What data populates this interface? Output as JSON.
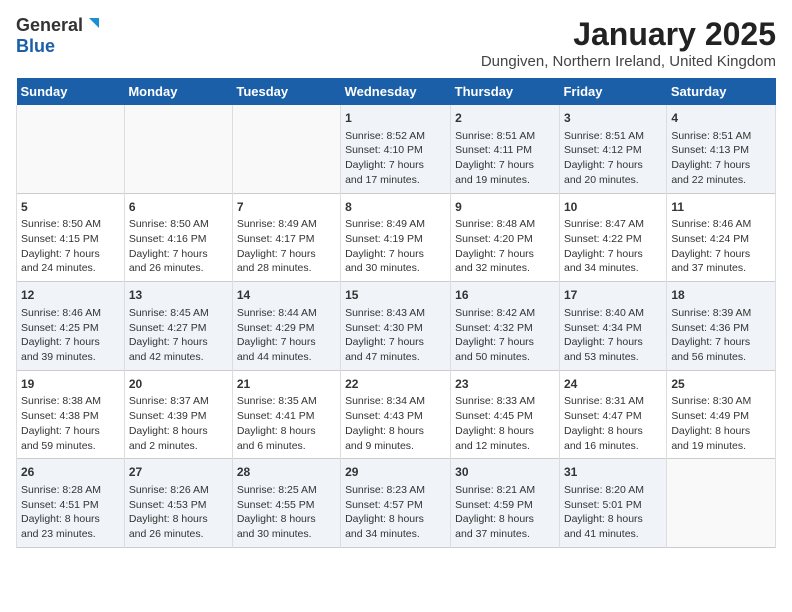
{
  "header": {
    "logo_general": "General",
    "logo_blue": "Blue",
    "month": "January 2025",
    "location": "Dungiven, Northern Ireland, United Kingdom"
  },
  "weekdays": [
    "Sunday",
    "Monday",
    "Tuesday",
    "Wednesday",
    "Thursday",
    "Friday",
    "Saturday"
  ],
  "weeks": [
    [
      {
        "day": "",
        "info": ""
      },
      {
        "day": "",
        "info": ""
      },
      {
        "day": "",
        "info": ""
      },
      {
        "day": "1",
        "info": "Sunrise: 8:52 AM\nSunset: 4:10 PM\nDaylight: 7 hours\nand 17 minutes."
      },
      {
        "day": "2",
        "info": "Sunrise: 8:51 AM\nSunset: 4:11 PM\nDaylight: 7 hours\nand 19 minutes."
      },
      {
        "day": "3",
        "info": "Sunrise: 8:51 AM\nSunset: 4:12 PM\nDaylight: 7 hours\nand 20 minutes."
      },
      {
        "day": "4",
        "info": "Sunrise: 8:51 AM\nSunset: 4:13 PM\nDaylight: 7 hours\nand 22 minutes."
      }
    ],
    [
      {
        "day": "5",
        "info": "Sunrise: 8:50 AM\nSunset: 4:15 PM\nDaylight: 7 hours\nand 24 minutes."
      },
      {
        "day": "6",
        "info": "Sunrise: 8:50 AM\nSunset: 4:16 PM\nDaylight: 7 hours\nand 26 minutes."
      },
      {
        "day": "7",
        "info": "Sunrise: 8:49 AM\nSunset: 4:17 PM\nDaylight: 7 hours\nand 28 minutes."
      },
      {
        "day": "8",
        "info": "Sunrise: 8:49 AM\nSunset: 4:19 PM\nDaylight: 7 hours\nand 30 minutes."
      },
      {
        "day": "9",
        "info": "Sunrise: 8:48 AM\nSunset: 4:20 PM\nDaylight: 7 hours\nand 32 minutes."
      },
      {
        "day": "10",
        "info": "Sunrise: 8:47 AM\nSunset: 4:22 PM\nDaylight: 7 hours\nand 34 minutes."
      },
      {
        "day": "11",
        "info": "Sunrise: 8:46 AM\nSunset: 4:24 PM\nDaylight: 7 hours\nand 37 minutes."
      }
    ],
    [
      {
        "day": "12",
        "info": "Sunrise: 8:46 AM\nSunset: 4:25 PM\nDaylight: 7 hours\nand 39 minutes."
      },
      {
        "day": "13",
        "info": "Sunrise: 8:45 AM\nSunset: 4:27 PM\nDaylight: 7 hours\nand 42 minutes."
      },
      {
        "day": "14",
        "info": "Sunrise: 8:44 AM\nSunset: 4:29 PM\nDaylight: 7 hours\nand 44 minutes."
      },
      {
        "day": "15",
        "info": "Sunrise: 8:43 AM\nSunset: 4:30 PM\nDaylight: 7 hours\nand 47 minutes."
      },
      {
        "day": "16",
        "info": "Sunrise: 8:42 AM\nSunset: 4:32 PM\nDaylight: 7 hours\nand 50 minutes."
      },
      {
        "day": "17",
        "info": "Sunrise: 8:40 AM\nSunset: 4:34 PM\nDaylight: 7 hours\nand 53 minutes."
      },
      {
        "day": "18",
        "info": "Sunrise: 8:39 AM\nSunset: 4:36 PM\nDaylight: 7 hours\nand 56 minutes."
      }
    ],
    [
      {
        "day": "19",
        "info": "Sunrise: 8:38 AM\nSunset: 4:38 PM\nDaylight: 7 hours\nand 59 minutes."
      },
      {
        "day": "20",
        "info": "Sunrise: 8:37 AM\nSunset: 4:39 PM\nDaylight: 8 hours\nand 2 minutes."
      },
      {
        "day": "21",
        "info": "Sunrise: 8:35 AM\nSunset: 4:41 PM\nDaylight: 8 hours\nand 6 minutes."
      },
      {
        "day": "22",
        "info": "Sunrise: 8:34 AM\nSunset: 4:43 PM\nDaylight: 8 hours\nand 9 minutes."
      },
      {
        "day": "23",
        "info": "Sunrise: 8:33 AM\nSunset: 4:45 PM\nDaylight: 8 hours\nand 12 minutes."
      },
      {
        "day": "24",
        "info": "Sunrise: 8:31 AM\nSunset: 4:47 PM\nDaylight: 8 hours\nand 16 minutes."
      },
      {
        "day": "25",
        "info": "Sunrise: 8:30 AM\nSunset: 4:49 PM\nDaylight: 8 hours\nand 19 minutes."
      }
    ],
    [
      {
        "day": "26",
        "info": "Sunrise: 8:28 AM\nSunset: 4:51 PM\nDaylight: 8 hours\nand 23 minutes."
      },
      {
        "day": "27",
        "info": "Sunrise: 8:26 AM\nSunset: 4:53 PM\nDaylight: 8 hours\nand 26 minutes."
      },
      {
        "day": "28",
        "info": "Sunrise: 8:25 AM\nSunset: 4:55 PM\nDaylight: 8 hours\nand 30 minutes."
      },
      {
        "day": "29",
        "info": "Sunrise: 8:23 AM\nSunset: 4:57 PM\nDaylight: 8 hours\nand 34 minutes."
      },
      {
        "day": "30",
        "info": "Sunrise: 8:21 AM\nSunset: 4:59 PM\nDaylight: 8 hours\nand 37 minutes."
      },
      {
        "day": "31",
        "info": "Sunrise: 8:20 AM\nSunset: 5:01 PM\nDaylight: 8 hours\nand 41 minutes."
      },
      {
        "day": "",
        "info": ""
      }
    ]
  ]
}
